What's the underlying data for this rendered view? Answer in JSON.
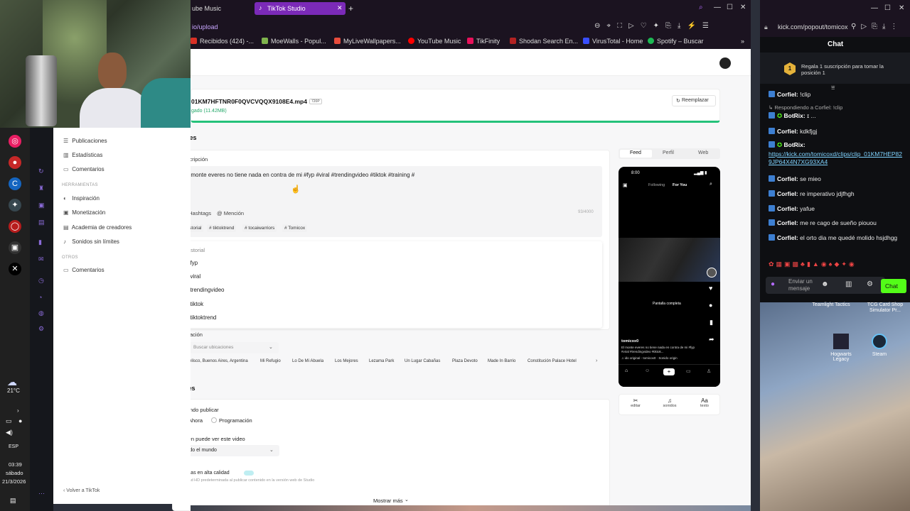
{
  "tabs": [
    {
      "label": "ube Music"
    },
    {
      "label": "TikTok Studio"
    }
  ],
  "url": "io/upload",
  "bookmarks": [
    {
      "label": "Recibidos (424) -...",
      "color": "#d93025"
    },
    {
      "label": "MoeWalls - Popul...",
      "color": "#7fb34d"
    },
    {
      "label": "MyLiveWallpapers...",
      "color": "#e84c3d"
    },
    {
      "label": "YouTube Music",
      "color": "#ff0000"
    },
    {
      "label": "TikFinity",
      "color": "#e8115b"
    },
    {
      "label": "Shodan Search En...",
      "color": "#b22222"
    },
    {
      "label": "VirusTotal - Home",
      "color": "#394eff"
    },
    {
      "label": "Spotify – Buscar",
      "color": "#1db954"
    }
  ],
  "file": {
    "name": "01KM7HFTNR0F0QVCVQQX9108E4.mp4",
    "badge": "720P",
    "status": "gado (11.42MB)",
    "replace_label": "Reemplazar"
  },
  "leftnav": {
    "items_top": [
      "Publicaciones",
      "Estadísticas",
      "Comentarios"
    ],
    "section_tools": "HERRAMIENTAS",
    "items_tools": [
      "Inspiración",
      "Monetización",
      "Academia de creadores",
      "Sonidos sin límites"
    ],
    "section_others": "OTROS",
    "items_others": [
      "Comentarios"
    ],
    "back_label": "Volver a TikTok"
  },
  "details": {
    "heading": "Detalles",
    "desc_label": "Descripción",
    "desc_text": "El monte everes no tiene nada en contra de mi #fyp #viral #trendingvideo #tiktok #training #",
    "hashtags_label": "# Hashtags",
    "mention_label": "@ Mención",
    "counter": "93/4000",
    "tags": [
      "Historial",
      "# tiktoktrend",
      "# tocaiwarriors",
      "# Tomicox"
    ],
    "history_title": "Historial",
    "history_items": [
      "#fyp",
      "#viral",
      "#trendingvideo",
      "#tiktok",
      "#tiktoktrend"
    ],
    "location_label": "Ubicación",
    "location_placeholder": "Buscar ubicaciones",
    "locations": [
      "Obelisco, Buenos Aires, Argentina",
      "Mi Refugio",
      "Lo De Mi Abuela",
      "Los Mejores",
      "Lezama Park",
      "Un Lugar Cabañas",
      "Plaza Devoto",
      "Made In Barrio",
      "Constitución Palace Hotel"
    ]
  },
  "settings": {
    "heading": "Ajustes",
    "when_label": "Cuándo publicar",
    "now_label": "Ahora",
    "schedule_label": "Programación",
    "who_label": "Quién puede ver este video",
    "who_value": "Todo el mundo",
    "hq_label": "Cargas en alta calidad",
    "hq_note": "Calidad HD predeterminada al publicar contenido en la versión web de Studio",
    "more_label": "Mostrar más"
  },
  "preview": {
    "tabs": [
      "Feed",
      "Perfil",
      "Web"
    ],
    "time": "8:00",
    "following": "Following",
    "foryou": "For You",
    "fullscreen": "Pantalla completa",
    "user": "tomicox0",
    "caption": "El monte everes no tiene nada en contra de mi #fyp #viral #trendingvideo #tiktok...",
    "sound": "♫ ido original - tomicox0 · Sonido origin",
    "nav": [
      "Home",
      "Friends",
      "",
      "Inbox",
      "Profile"
    ],
    "tools": [
      {
        "icon": "✂",
        "label": "editar"
      },
      {
        "icon": "♫",
        "label": "sonidos"
      },
      {
        "icon": "Aa",
        "label": "texto"
      }
    ]
  },
  "chat": {
    "url": "kick.com/popout/tomicox",
    "title": "Chat",
    "promo": "Regala 1 suscripción para tomar la posición 1",
    "promo_rank": "1",
    "messages": [
      {
        "nick": "Corfiel:",
        "text": "!clip"
      },
      {
        "nick": "",
        "text": "Respondiendo a Corfiel: !clip"
      },
      {
        "nick": "BotRix:",
        "text": "ɪ ..."
      },
      {
        "nick": "Corfiel:",
        "text": "kdkfjgj"
      },
      {
        "nick": "BotRix:",
        "text": ""
      },
      {
        "nick": "",
        "text": "https://kick.com/tomicoxd/clips/clip_01KM7HEP829JP64X4N7XG93XA4"
      },
      {
        "nick": "Corfiel:",
        "text": "se mieo"
      },
      {
        "nick": "Corfiel:",
        "text": "re imperativo jdjfhgh"
      },
      {
        "nick": "Corfiel:",
        "text": "yafue"
      },
      {
        "nick": "Corfiel:",
        "text": "me re cago de sueño piouou"
      },
      {
        "nick": "Corfiel:",
        "text": "el orto dia me quedé molido hsjdhgg"
      }
    ],
    "input_placeholder": "Enviar un mensaje",
    "send_label": "Chat"
  },
  "desktop": {
    "items": [
      "Hogwarts Legacy",
      "Steam",
      "TCG Card Shop Simulator Pr...",
      "Teamlight Tactics"
    ]
  },
  "system": {
    "temp": "21°C",
    "lang": "ESP",
    "time": "03:39",
    "day": "sábado",
    "date": "21/3/2026"
  }
}
